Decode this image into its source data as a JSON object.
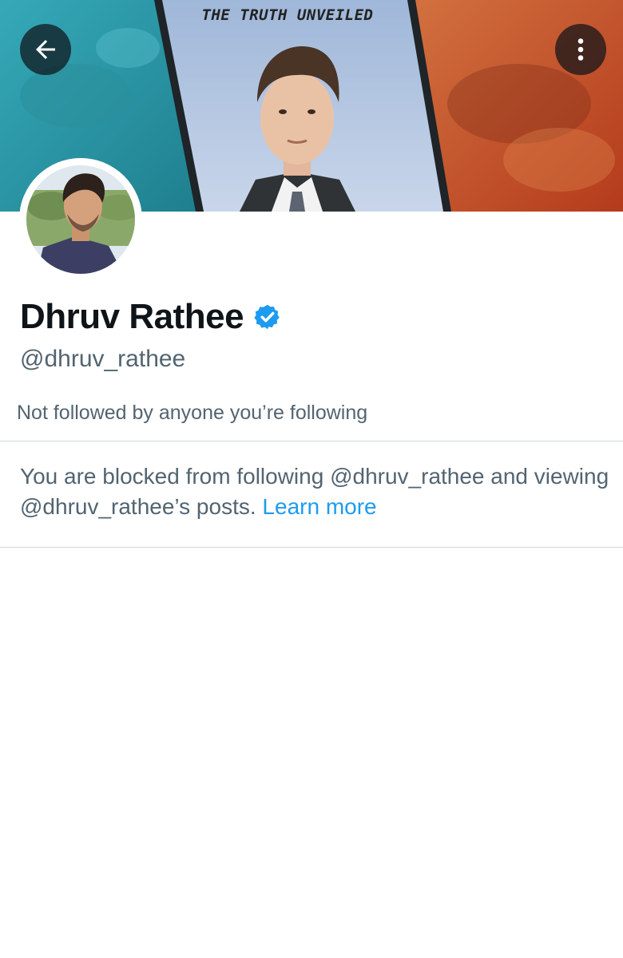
{
  "banner": {
    "title": "THE TRUTH UNVEILED"
  },
  "topbar": {
    "back_icon": "arrow-left-icon",
    "more_icon": "more-vertical-icon"
  },
  "profile": {
    "display_name": "Dhruv Rathee",
    "verified_icon": "verified-badge-icon",
    "verified_color": "#1d9bf0",
    "handle": "@dhruv_rathee",
    "followers_you_know": "Not followed by anyone you’re following"
  },
  "blocked": {
    "message": "You are blocked from following @dhruv_rathee and viewing @dhruv_rathee’s posts.",
    "link_label": "Learn more",
    "link_color": "#1d9bf0"
  }
}
